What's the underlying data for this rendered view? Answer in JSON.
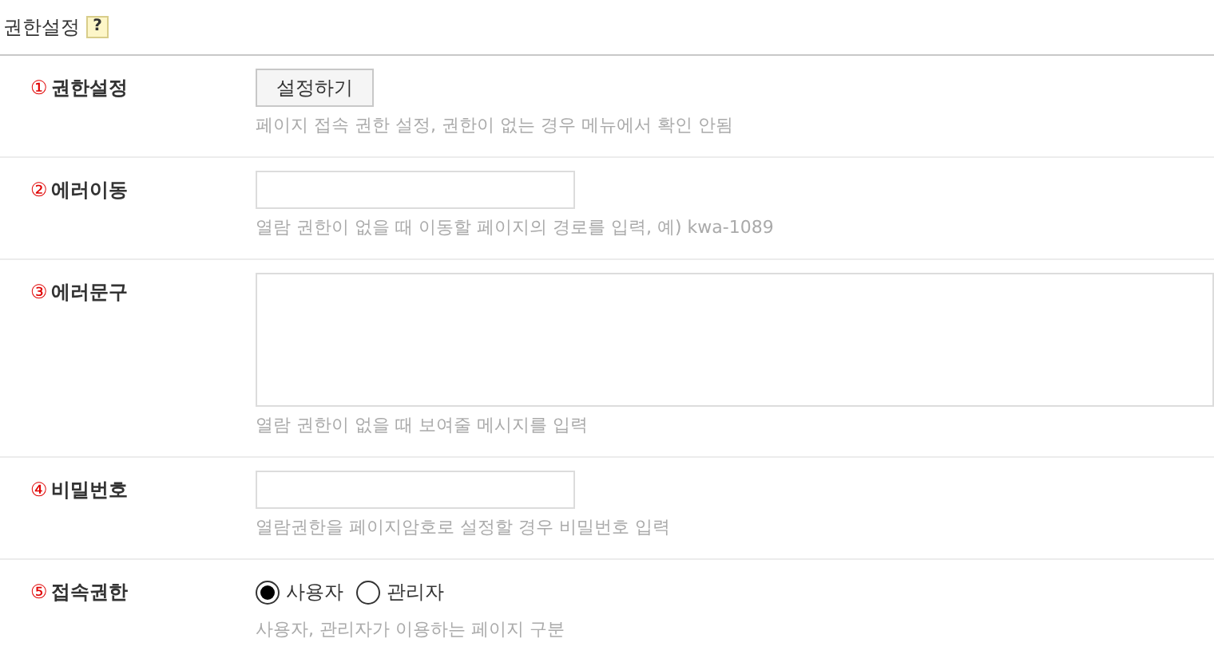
{
  "section": {
    "title": "권한설정",
    "help": "?"
  },
  "rows": [
    {
      "number": "①",
      "label": "권한설정",
      "kind": "button",
      "button": "설정하기",
      "hint": "페이지 접속 권한 설정, 권한이 없는 경우 메뉴에서 확인 안됨"
    },
    {
      "number": "②",
      "label": "에러이동",
      "kind": "input",
      "hint": "열람 권한이 없을 때 이동할 페이지의 경로를 입력, 예) kwa-1089"
    },
    {
      "number": "③",
      "label": "에러문구",
      "kind": "textarea",
      "hint": "열람 권한이 없을 때 보여줄 메시지를 입력"
    },
    {
      "number": "④",
      "label": "비밀번호",
      "kind": "input",
      "hint": "열람권한을 페이지암호로 설정할 경우 비밀번호 입력"
    },
    {
      "number": "⑤",
      "label": "접속권한",
      "kind": "radio",
      "options": [
        {
          "label": "사용자",
          "selected": true
        },
        {
          "label": "관리자",
          "selected": false
        }
      ],
      "hint": "사용자, 관리자가 이용하는 페이지 구분"
    }
  ]
}
